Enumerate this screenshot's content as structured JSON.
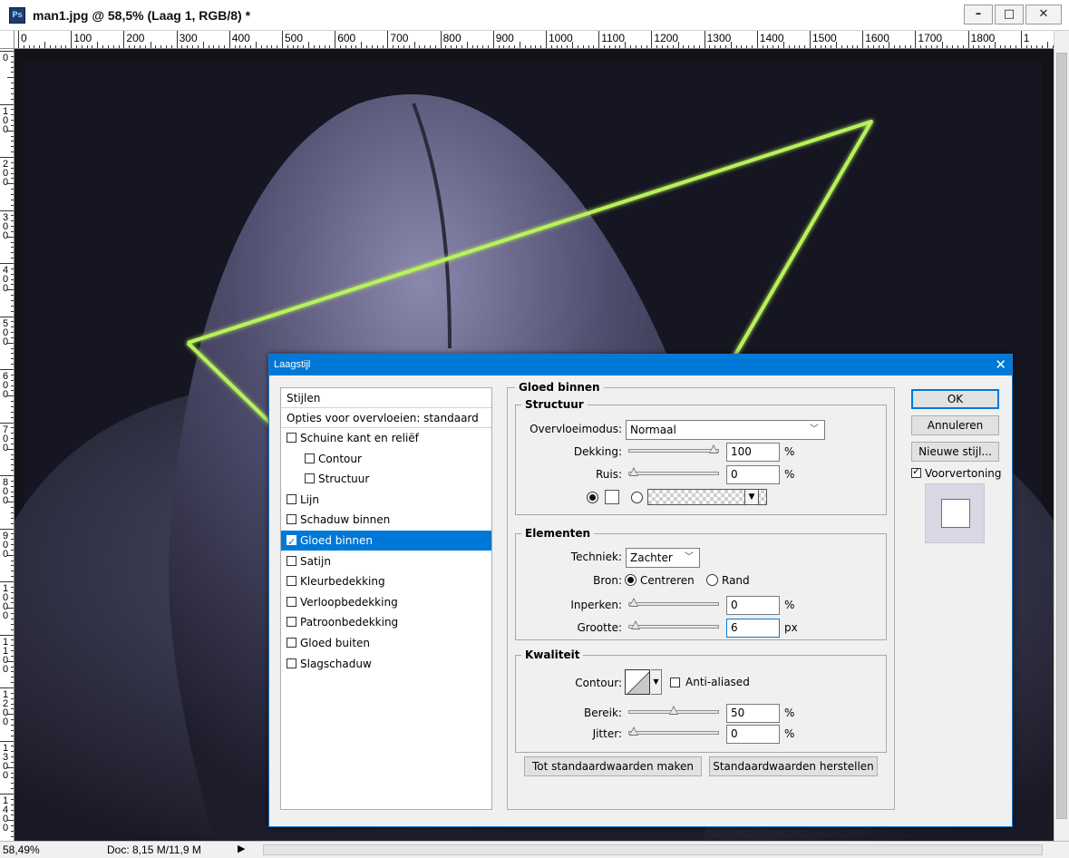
{
  "window": {
    "app_logo": "Ps",
    "title": "man1.jpg @ 58,5% (Laag 1, RGB/8) *",
    "minimize": "–",
    "maximize": "□",
    "close": "✕"
  },
  "ruler": {
    "horizontal": [
      "0",
      "100",
      "200",
      "300",
      "400",
      "500",
      "600",
      "700",
      "800",
      "900",
      "1000",
      "1100",
      "1200",
      "1300",
      "1400",
      "1500",
      "1600",
      "1700",
      "1800",
      "1"
    ],
    "vertical": [
      "0",
      "100",
      "200",
      "300",
      "400",
      "500",
      "600",
      "700",
      "800",
      "900",
      "1000",
      "1100",
      "1200",
      "1300",
      "1400"
    ]
  },
  "status": {
    "zoom": "58,49%",
    "doc": "Doc: 8,15 M/11,9 M",
    "arrow": "▶"
  },
  "dialog": {
    "title": "Laagstijl",
    "close": "✕",
    "styles": {
      "header": "Stijlen",
      "blend_options": "Opties voor overvloeien: standaard",
      "items": [
        {
          "label": "Schuine kant en reliëf",
          "checked": false,
          "sub": false
        },
        {
          "label": "Contour",
          "checked": false,
          "sub": true
        },
        {
          "label": "Structuur",
          "checked": false,
          "sub": true
        },
        {
          "label": "Lijn",
          "checked": false,
          "sub": false
        },
        {
          "label": "Schaduw binnen",
          "checked": false,
          "sub": false
        },
        {
          "label": "Gloed binnen",
          "checked": true,
          "sub": false,
          "selected": true
        },
        {
          "label": "Satijn",
          "checked": false,
          "sub": false
        },
        {
          "label": "Kleurbedekking",
          "checked": false,
          "sub": false
        },
        {
          "label": "Verloopbedekking",
          "checked": false,
          "sub": false
        },
        {
          "label": "Patroonbedekking",
          "checked": false,
          "sub": false
        },
        {
          "label": "Gloed buiten",
          "checked": false,
          "sub": false
        },
        {
          "label": "Slagschaduw",
          "checked": false,
          "sub": false
        }
      ]
    },
    "section_title": "Gloed binnen",
    "structuur": {
      "label": "Structuur",
      "blend_mode_label": "Overvloeimodus:",
      "blend_mode_value": "Normaal",
      "opacity_label": "Dekking:",
      "opacity_value": "100",
      "opacity_level": 100,
      "noise_label": "Ruis:",
      "noise_value": "0",
      "noise_level": 0,
      "unit_pct": "%"
    },
    "elementen": {
      "label": "Elementen",
      "technique_label": "Techniek:",
      "technique_value": "Zachter",
      "source_label": "Bron:",
      "source_center": "Centreren",
      "source_edge": "Rand",
      "choke_label": "Inperken:",
      "choke_value": "0",
      "choke_level": 0,
      "size_label": "Grootte:",
      "size_value": "6",
      "size_level": 2,
      "unit_px": "px"
    },
    "kwaliteit": {
      "label": "Kwaliteit",
      "contour_label": "Contour:",
      "anti_aliased": "Anti-aliased",
      "range_label": "Bereik:",
      "range_value": "50",
      "range_level": 50,
      "jitter_label": "Jitter:",
      "jitter_value": "0",
      "jitter_level": 0
    },
    "buttons": {
      "make_default": "Tot standaardwaarden maken",
      "reset_default": "Standaardwaarden herstellen",
      "ok": "OK",
      "cancel": "Annuleren",
      "new_style": "Nieuwe stijl...",
      "preview": "Voorvertoning"
    }
  },
  "colors": {
    "accent": "#0078d7",
    "neon": "#b9f25a"
  }
}
